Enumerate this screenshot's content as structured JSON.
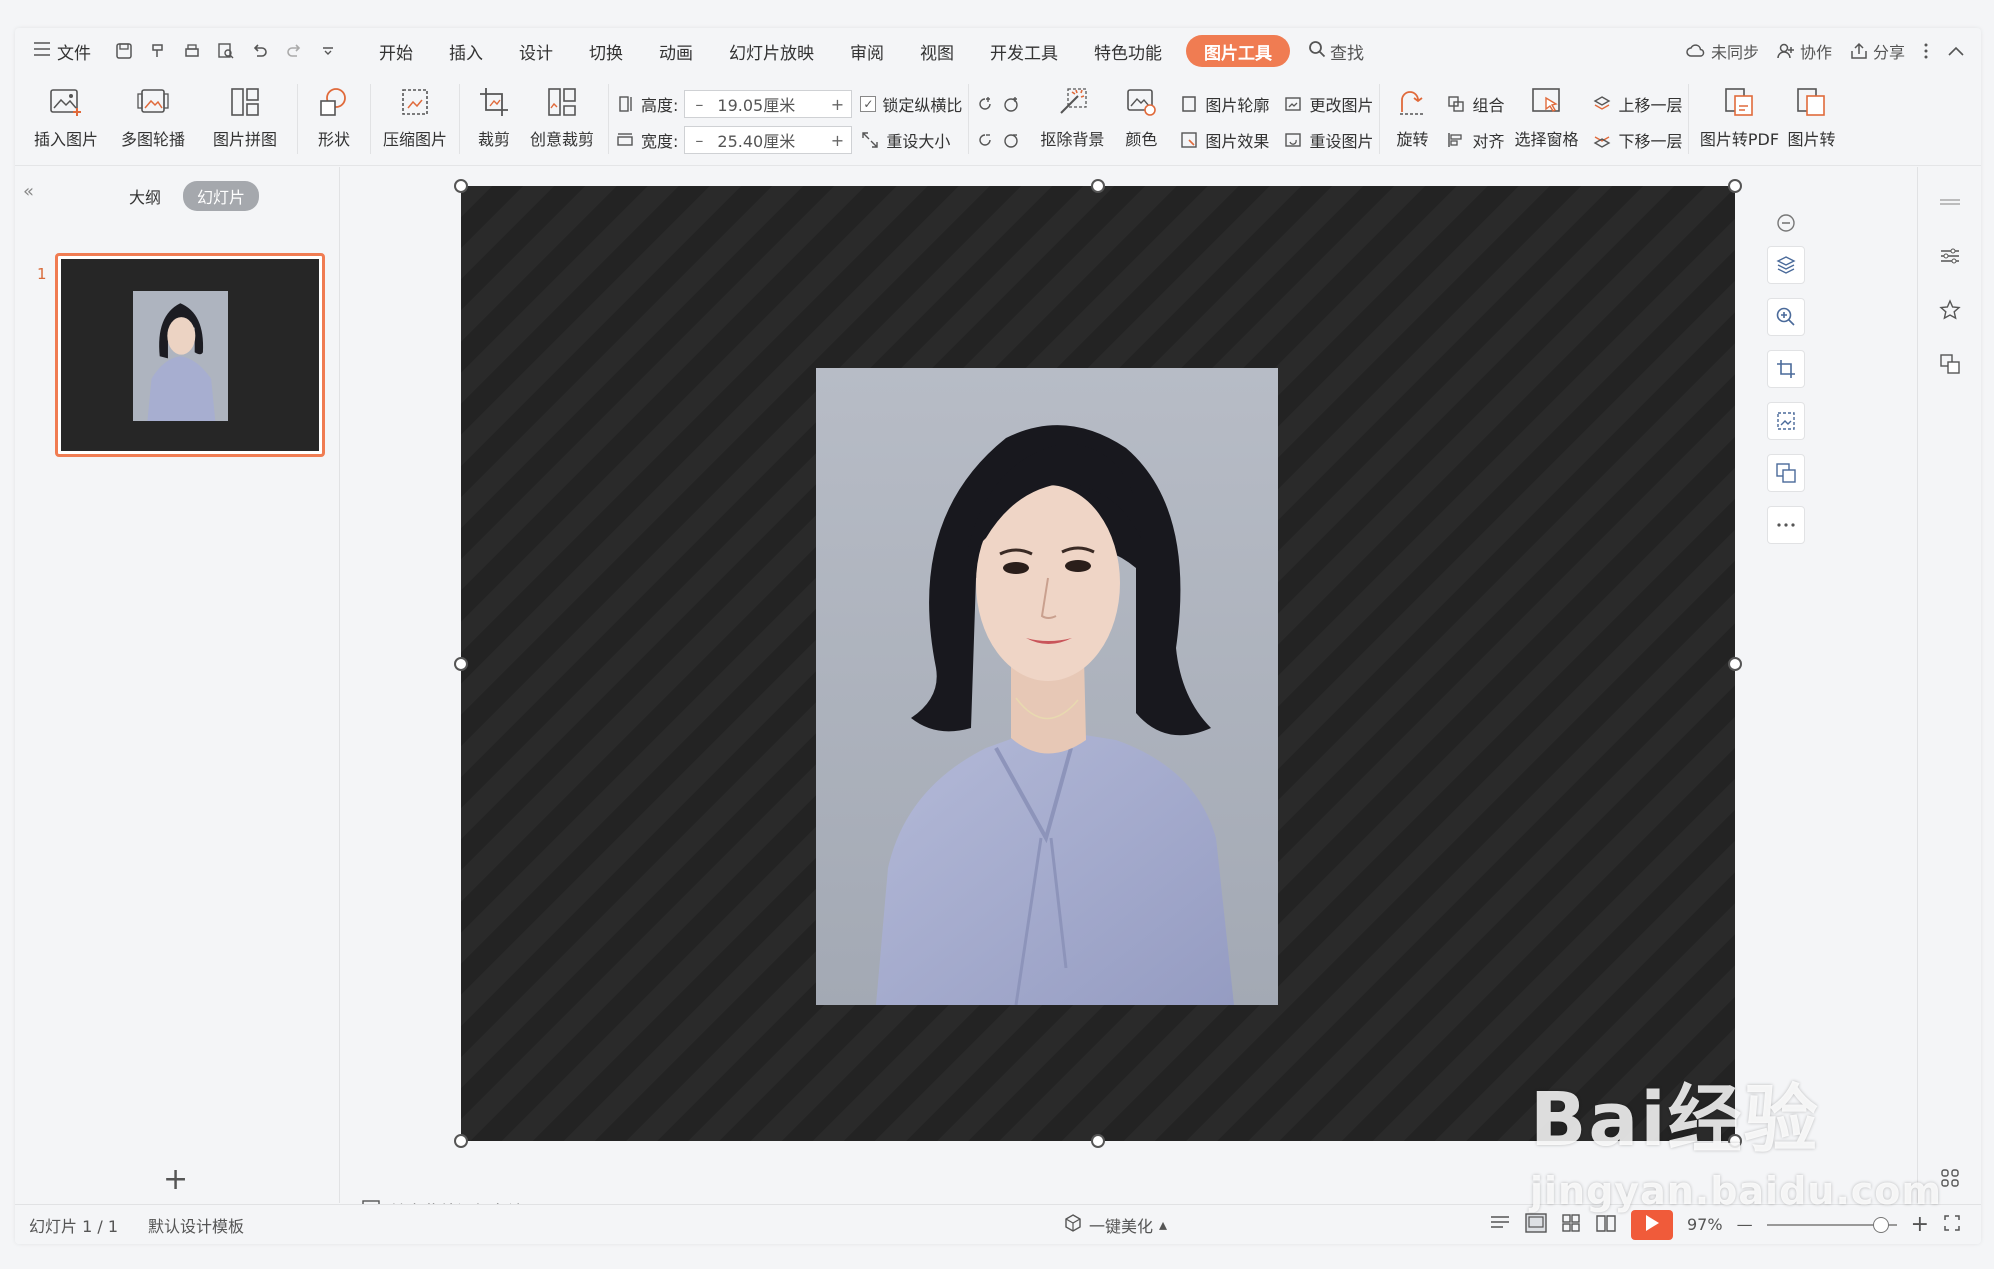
{
  "menubar": {
    "file_label": "文件",
    "tabs": [
      "开始",
      "插入",
      "设计",
      "切换",
      "动画",
      "幻灯片放映",
      "审阅",
      "视图",
      "开发工具",
      "特色功能",
      "图片工具"
    ],
    "active_tab": "图片工具",
    "search_label": "查找",
    "right": {
      "sync": "未同步",
      "collab": "协作",
      "share": "分享"
    }
  },
  "ribbon": {
    "insert_picture": "插入图片",
    "multi_carousel": "多图轮播",
    "picture_collage": "图片拼图",
    "shape": "形状",
    "compress": "压缩图片",
    "crop": "裁剪",
    "creative_crop": "创意裁剪",
    "height_label": "高度:",
    "height_value": "19.05厘米",
    "width_label": "宽度:",
    "width_value": "25.40厘米",
    "lock_ratio": "锁定纵横比",
    "reset_size": "重设大小",
    "remove_bg": "抠除背景",
    "color": "颜色",
    "picture_outline": "图片轮廓",
    "picture_effects": "图片效果",
    "change_picture": "更改图片",
    "reset_picture": "重设图片",
    "rotate": "旋转",
    "group": "组合",
    "align": "对齐",
    "selection_pane": "选择窗格",
    "bring_forward": "上移一层",
    "send_backward": "下移一层",
    "to_pdf": "图片转PDF",
    "to_more": "图片转"
  },
  "leftpanel": {
    "outline_tab": "大纲",
    "slides_tab": "幻灯片",
    "slide_number": "1",
    "add_icon": "+"
  },
  "notes": {
    "placeholder": "单击此处添加备注"
  },
  "statusbar": {
    "slide_info": "幻灯片 1 / 1",
    "template": "默认设计模板",
    "beautify": "一键美化",
    "zoom": "97%"
  },
  "watermark": {
    "main": "Bai经验",
    "sub": "jingyan.baidu.com"
  },
  "colors": {
    "accent": "#f07c52",
    "slide_bg": "#252525",
    "photo_bg": "#aeb4bf",
    "blouse": "#a7aed0"
  }
}
